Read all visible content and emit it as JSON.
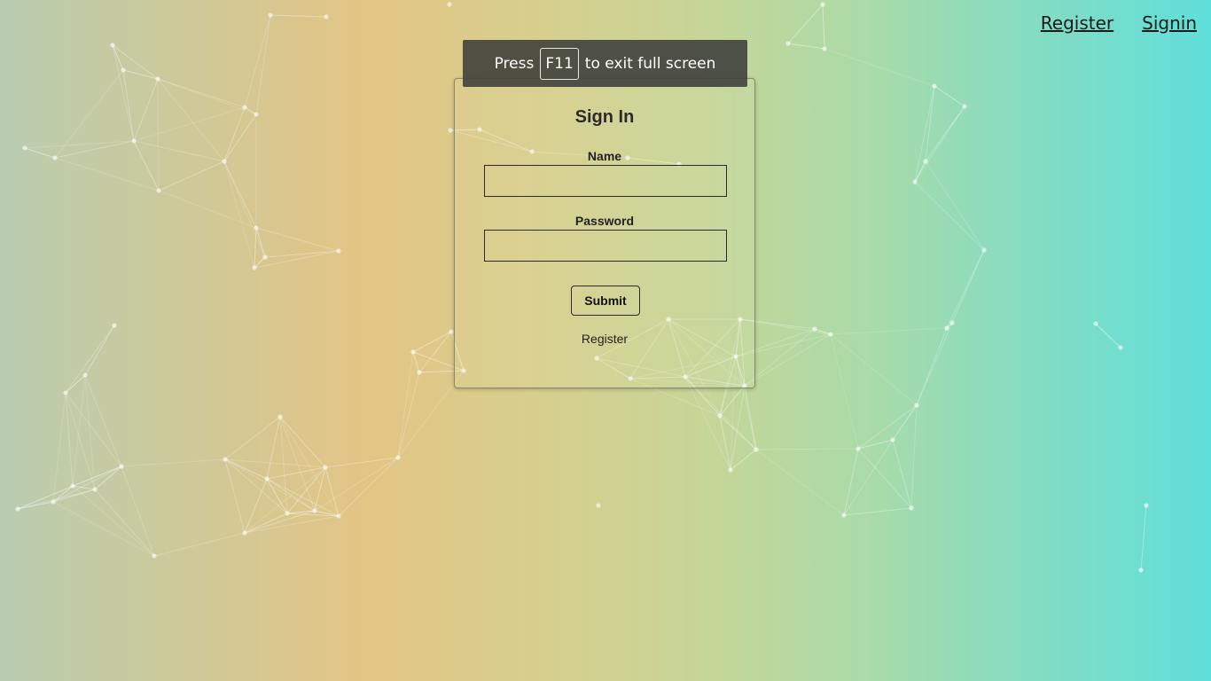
{
  "nav": {
    "register_label": "Register",
    "signin_label": "Signin"
  },
  "fullscreen_notice": {
    "prefix": "Press",
    "key": "F11",
    "suffix": "to exit full screen"
  },
  "signin_form": {
    "title": "Sign In",
    "name_label": "Name",
    "name_value": "",
    "password_label": "Password",
    "password_value": "",
    "submit_label": "Submit",
    "register_link": "Register"
  },
  "colors": {
    "gradient_left": "#b9cdb0",
    "gradient_warm": "#e3c585",
    "gradient_right": "#5fdfda",
    "network_line": "#ffffff"
  }
}
